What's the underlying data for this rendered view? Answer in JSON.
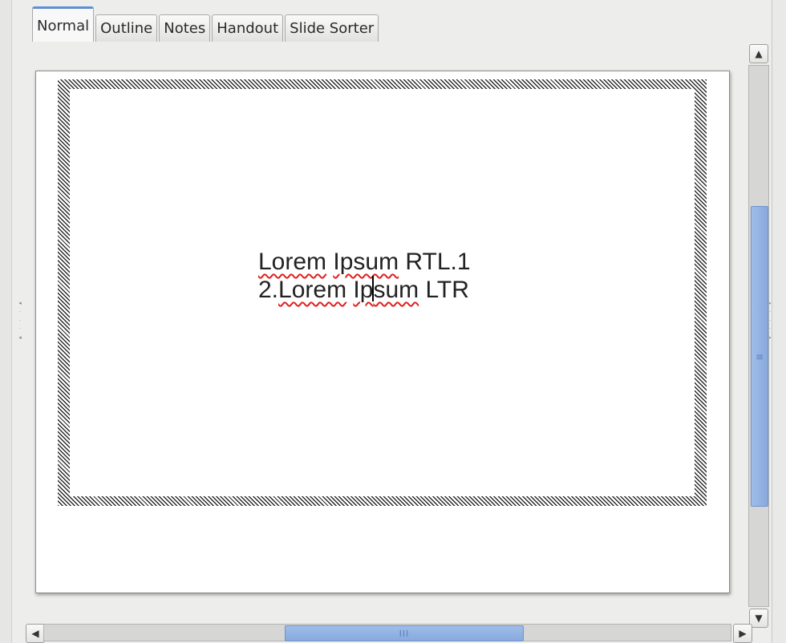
{
  "tabs": [
    {
      "label": "Normal",
      "active": true
    },
    {
      "label": "Outline",
      "active": false
    },
    {
      "label": "Notes",
      "active": false
    },
    {
      "label": "Handout",
      "active": false
    },
    {
      "label": "Slide Sorter",
      "active": false
    }
  ],
  "slide": {
    "line1": {
      "word1": "Lorem",
      "word2": "Ipsum",
      "rest": " RTL.1"
    },
    "line2": {
      "prefix": "2.",
      "word1": "Lorem",
      "word2_before_caret": "Ip",
      "word2_after_caret": "sum",
      "rest": " LTR"
    }
  },
  "icons": {
    "scroll_up": "▲",
    "scroll_down": "▼",
    "scroll_left": "◀",
    "scroll_right": "▶",
    "vthumb_grip": "≡",
    "hthumb_grip": "III"
  },
  "colors": {
    "accent": "#5f8fd3",
    "scroll_thumb": "#9fbde9",
    "spellcheck": "#e02020"
  }
}
